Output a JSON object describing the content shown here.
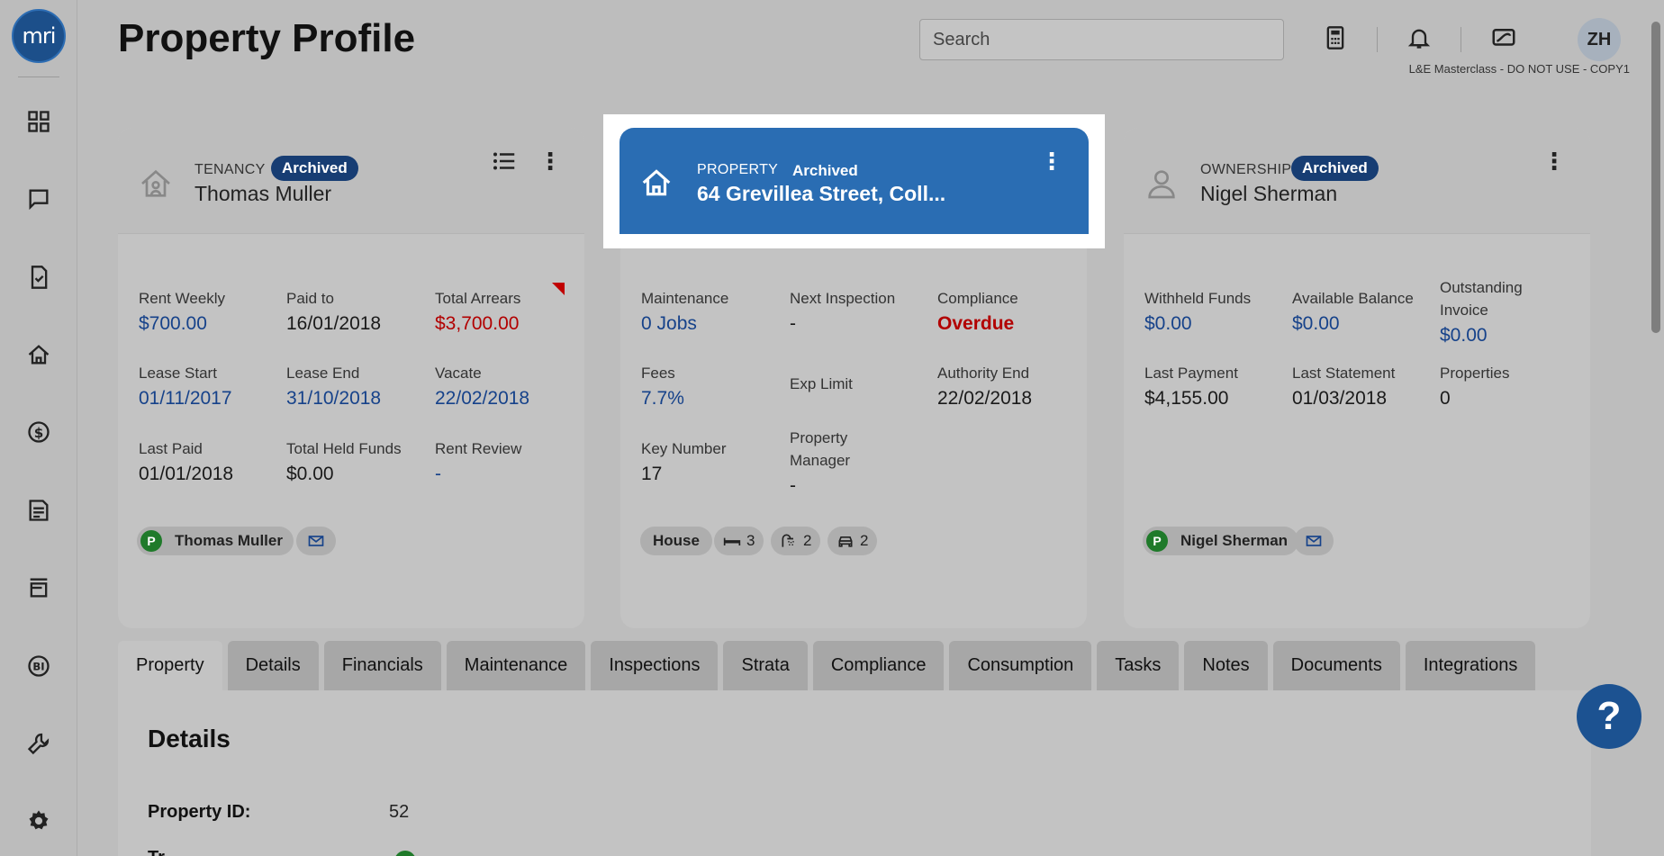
{
  "app": {
    "logo_text": "mri",
    "page_title": "Property Profile"
  },
  "header": {
    "search_placeholder": "Search",
    "avatar_initials": "ZH",
    "environment": "L&E Masterclass - DO NOT USE - COPY1"
  },
  "sidebar": {
    "items": [
      "dashboard-icon",
      "messages-icon",
      "tasks-icon",
      "properties-icon",
      "financials-icon",
      "reports-icon",
      "listings-icon",
      "bi-icon",
      "tools-icon",
      "settings-icon"
    ]
  },
  "tenancy": {
    "type": "TENANCY",
    "status": "Archived",
    "name": "Thomas Muller",
    "fields": {
      "rent_weekly_label": "Rent Weekly",
      "rent_weekly": "$700.00",
      "paid_to_label": "Paid to",
      "paid_to": "16/01/2018",
      "total_arrears_label": "Total Arrears",
      "total_arrears": "$3,700.00",
      "lease_start_label": "Lease Start",
      "lease_start": "01/11/2017",
      "lease_end_label": "Lease End",
      "lease_end": "31/10/2018",
      "vacate_label": "Vacate",
      "vacate": "22/02/2018",
      "last_paid_label": "Last Paid",
      "last_paid": "01/01/2018",
      "held_funds_label": "Total Held Funds",
      "held_funds": "$0.00",
      "rent_review_label": "Rent Review",
      "rent_review": "-"
    },
    "contact_initial": "P",
    "contact_name": "Thomas Muller"
  },
  "property": {
    "type": "PROPERTY",
    "status": "Archived",
    "address": "64 Grevillea Street, Coll...",
    "fields": {
      "maintenance_label": "Maintenance",
      "maintenance": "0 Jobs",
      "next_inspection_label": "Next Inspection",
      "next_inspection": "-",
      "compliance_label": "Compliance",
      "compliance": "Overdue",
      "fees_label": "Fees",
      "fees": "7.7%",
      "exp_limit_label": "Exp Limit",
      "authority_end_label": "Authority End",
      "authority_end": "22/02/2018",
      "key_number_label": "Key Number",
      "key_number": "17",
      "property_manager_label": "Property Manager",
      "property_manager": "-"
    },
    "features": {
      "type": "House",
      "bedrooms": "3",
      "bathrooms": "2",
      "car_spaces": "2"
    }
  },
  "ownership": {
    "type": "OWNERSHIP",
    "status": "Archived",
    "name": "Nigel Sherman",
    "fields": {
      "withheld_label": "Withheld Funds",
      "withheld": "$0.00",
      "available_label": "Available Balance",
      "available": "$0.00",
      "outstanding_label": "Outstanding Invoice",
      "outstanding": "$0.00",
      "last_payment_label": "Last Payment",
      "last_payment": "$4,155.00",
      "last_statement_label": "Last Statement",
      "last_statement": "01/03/2018",
      "properties_label": "Properties",
      "properties": "0"
    },
    "contact_initial": "P",
    "contact_name": "Nigel Sherman"
  },
  "tabs": [
    "Property",
    "Details",
    "Financials",
    "Maintenance",
    "Inspections",
    "Strata",
    "Compliance",
    "Consumption",
    "Tasks",
    "Notes",
    "Documents",
    "Integrations"
  ],
  "details": {
    "title": "Details",
    "property_id_label": "Property ID:",
    "property_id": "52",
    "next_label": "Tr..."
  },
  "help_label": "?"
}
